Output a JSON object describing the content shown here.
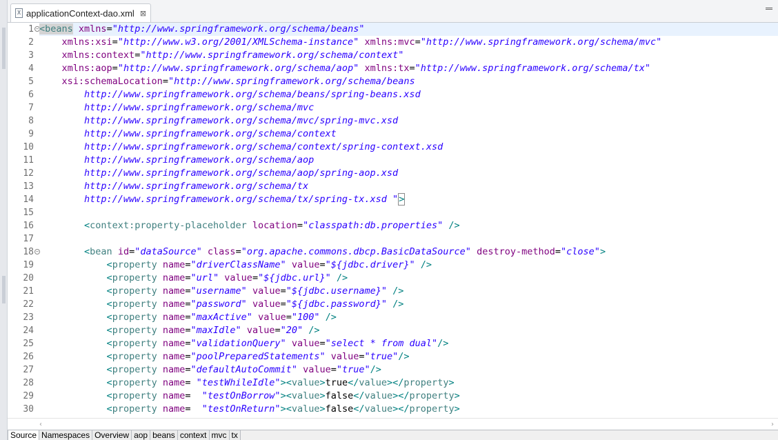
{
  "editor_tab": {
    "title": "applicationContext-dao.xml",
    "icon": "xml-file-icon",
    "close_glyph": "⊠",
    "icon_glyph": "X"
  },
  "current_line": 1,
  "fold_lines": [
    1,
    18
  ],
  "lines": [
    [
      [
        "tagsel",
        "<beans"
      ],
      [
        "sp",
        " "
      ],
      [
        "at",
        "xmlns"
      ],
      [
        "sp",
        "="
      ],
      [
        "av",
        "\"http://www.springframework.org/schema/beans\""
      ]
    ],
    [
      [
        "sp",
        "    "
      ],
      [
        "at",
        "xmlns:xsi"
      ],
      [
        "sp",
        "="
      ],
      [
        "av",
        "\"http://www.w3.org/2001/XMLSchema-instance\""
      ],
      [
        "sp",
        " "
      ],
      [
        "at",
        "xmlns:mvc"
      ],
      [
        "sp",
        "="
      ],
      [
        "av",
        "\"http://www.springframework.org/schema/mvc\""
      ]
    ],
    [
      [
        "sp",
        "    "
      ],
      [
        "at",
        "xmlns:context"
      ],
      [
        "sp",
        "="
      ],
      [
        "av",
        "\"http://www.springframework.org/schema/context\""
      ]
    ],
    [
      [
        "sp",
        "    "
      ],
      [
        "at",
        "xmlns:aop"
      ],
      [
        "sp",
        "="
      ],
      [
        "av",
        "\"http://www.springframework.org/schema/aop\""
      ],
      [
        "sp",
        " "
      ],
      [
        "at",
        "xmlns:tx"
      ],
      [
        "sp",
        "="
      ],
      [
        "av",
        "\"http://www.springframework.org/schema/tx\""
      ]
    ],
    [
      [
        "sp",
        "    "
      ],
      [
        "at",
        "xsi:schemaLocation"
      ],
      [
        "sp",
        "="
      ],
      [
        "av",
        "\"http://www.springframework.org/schema/beans"
      ]
    ],
    [
      [
        "sp",
        "        "
      ],
      [
        "av",
        "http://www.springframework.org/schema/beans/spring-beans.xsd"
      ]
    ],
    [
      [
        "sp",
        "        "
      ],
      [
        "av",
        "http://www.springframework.org/schema/mvc"
      ]
    ],
    [
      [
        "sp",
        "        "
      ],
      [
        "av",
        "http://www.springframework.org/schema/mvc/spring-mvc.xsd"
      ]
    ],
    [
      [
        "sp",
        "        "
      ],
      [
        "av",
        "http://www.springframework.org/schema/context"
      ]
    ],
    [
      [
        "sp",
        "        "
      ],
      [
        "av",
        "http://www.springframework.org/schema/context/spring-context.xsd"
      ]
    ],
    [
      [
        "sp",
        "        "
      ],
      [
        "av",
        "http://www.springframework.org/schema/aop"
      ]
    ],
    [
      [
        "sp",
        "        "
      ],
      [
        "av",
        "http://www.springframework.org/schema/aop/spring-aop.xsd"
      ]
    ],
    [
      [
        "sp",
        "        "
      ],
      [
        "av",
        "http://www.springframework.org/schema/tx"
      ]
    ],
    [
      [
        "sp",
        "        "
      ],
      [
        "av",
        "http://www.springframework.org/schema/tx/spring-tx.xsd \""
      ],
      [
        "box",
        ">"
      ]
    ],
    [],
    [
      [
        "sp",
        "        "
      ],
      [
        "pt",
        "<"
      ],
      [
        "tn",
        "context:property-placeholder"
      ],
      [
        "sp",
        " "
      ],
      [
        "at",
        "location"
      ],
      [
        "sp",
        "="
      ],
      [
        "av",
        "\"classpath:db.properties\""
      ],
      [
        "sp",
        " "
      ],
      [
        "pt",
        "/>"
      ]
    ],
    [],
    [
      [
        "sp",
        "        "
      ],
      [
        "pt",
        "<"
      ],
      [
        "tn",
        "bean"
      ],
      [
        "sp",
        " "
      ],
      [
        "at",
        "id"
      ],
      [
        "sp",
        "="
      ],
      [
        "av",
        "\"dataSource\""
      ],
      [
        "sp",
        " "
      ],
      [
        "at",
        "class"
      ],
      [
        "sp",
        "="
      ],
      [
        "av",
        "\"org.apache.commons.dbcp.BasicDataSource\""
      ],
      [
        "sp",
        " "
      ],
      [
        "at",
        "destroy-method"
      ],
      [
        "sp",
        "="
      ],
      [
        "av",
        "\"close\""
      ],
      [
        "pt",
        ">"
      ]
    ],
    [
      [
        "sp",
        "            "
      ],
      [
        "pt",
        "<"
      ],
      [
        "tn",
        "property"
      ],
      [
        "sp",
        " "
      ],
      [
        "at",
        "name"
      ],
      [
        "sp",
        "="
      ],
      [
        "av",
        "\"driverClassName\""
      ],
      [
        "sp",
        " "
      ],
      [
        "at",
        "value"
      ],
      [
        "sp",
        "="
      ],
      [
        "av",
        "\"${jdbc.driver}\""
      ],
      [
        "sp",
        " "
      ],
      [
        "pt",
        "/>"
      ]
    ],
    [
      [
        "sp",
        "            "
      ],
      [
        "pt",
        "<"
      ],
      [
        "tn",
        "property"
      ],
      [
        "sp",
        " "
      ],
      [
        "at",
        "name"
      ],
      [
        "sp",
        "="
      ],
      [
        "av",
        "\"url\""
      ],
      [
        "sp",
        " "
      ],
      [
        "at",
        "value"
      ],
      [
        "sp",
        "="
      ],
      [
        "av",
        "\"${jdbc.url}\""
      ],
      [
        "sp",
        " "
      ],
      [
        "pt",
        "/>"
      ]
    ],
    [
      [
        "sp",
        "            "
      ],
      [
        "pt",
        "<"
      ],
      [
        "tn",
        "property"
      ],
      [
        "sp",
        " "
      ],
      [
        "at",
        "name"
      ],
      [
        "sp",
        "="
      ],
      [
        "av",
        "\"username\""
      ],
      [
        "sp",
        " "
      ],
      [
        "at",
        "value"
      ],
      [
        "sp",
        "="
      ],
      [
        "av",
        "\"${jdbc.username}\""
      ],
      [
        "sp",
        " "
      ],
      [
        "pt",
        "/>"
      ]
    ],
    [
      [
        "sp",
        "            "
      ],
      [
        "pt",
        "<"
      ],
      [
        "tn",
        "property"
      ],
      [
        "sp",
        " "
      ],
      [
        "at",
        "name"
      ],
      [
        "sp",
        "="
      ],
      [
        "av",
        "\"password\""
      ],
      [
        "sp",
        " "
      ],
      [
        "at",
        "value"
      ],
      [
        "sp",
        "="
      ],
      [
        "av",
        "\"${jdbc.password}\""
      ],
      [
        "sp",
        " "
      ],
      [
        "pt",
        "/>"
      ]
    ],
    [
      [
        "sp",
        "            "
      ],
      [
        "pt",
        "<"
      ],
      [
        "tn",
        "property"
      ],
      [
        "sp",
        " "
      ],
      [
        "at",
        "name"
      ],
      [
        "sp",
        "="
      ],
      [
        "av",
        "\"maxActive\""
      ],
      [
        "sp",
        " "
      ],
      [
        "at",
        "value"
      ],
      [
        "sp",
        "="
      ],
      [
        "av",
        "\"100\""
      ],
      [
        "sp",
        " "
      ],
      [
        "pt",
        "/>"
      ]
    ],
    [
      [
        "sp",
        "            "
      ],
      [
        "pt",
        "<"
      ],
      [
        "tn",
        "property"
      ],
      [
        "sp",
        " "
      ],
      [
        "at",
        "name"
      ],
      [
        "sp",
        "="
      ],
      [
        "av",
        "\"maxIdle\""
      ],
      [
        "sp",
        " "
      ],
      [
        "at",
        "value"
      ],
      [
        "sp",
        "="
      ],
      [
        "av",
        "\"20\""
      ],
      [
        "sp",
        " "
      ],
      [
        "pt",
        "/>"
      ]
    ],
    [
      [
        "sp",
        "            "
      ],
      [
        "pt",
        "<"
      ],
      [
        "tn",
        "property"
      ],
      [
        "sp",
        " "
      ],
      [
        "at",
        "name"
      ],
      [
        "sp",
        "="
      ],
      [
        "av",
        "\"validationQuery\""
      ],
      [
        "sp",
        " "
      ],
      [
        "at",
        "value"
      ],
      [
        "sp",
        "="
      ],
      [
        "av",
        "\"select * from dual\""
      ],
      [
        "pt",
        "/>"
      ]
    ],
    [
      [
        "sp",
        "            "
      ],
      [
        "pt",
        "<"
      ],
      [
        "tn",
        "property"
      ],
      [
        "sp",
        " "
      ],
      [
        "at",
        "name"
      ],
      [
        "sp",
        "="
      ],
      [
        "av",
        "\"poolPreparedStatements\""
      ],
      [
        "sp",
        " "
      ],
      [
        "at",
        "value"
      ],
      [
        "sp",
        "="
      ],
      [
        "av",
        "\"true\""
      ],
      [
        "pt",
        "/>"
      ]
    ],
    [
      [
        "sp",
        "            "
      ],
      [
        "pt",
        "<"
      ],
      [
        "tn",
        "property"
      ],
      [
        "sp",
        " "
      ],
      [
        "at",
        "name"
      ],
      [
        "sp",
        "="
      ],
      [
        "av",
        "\"defaultAutoCommit\""
      ],
      [
        "sp",
        " "
      ],
      [
        "at",
        "value"
      ],
      [
        "sp",
        "="
      ],
      [
        "av",
        "\"true\""
      ],
      [
        "pt",
        "/>"
      ]
    ],
    [
      [
        "sp",
        "            "
      ],
      [
        "pt",
        "<"
      ],
      [
        "tn",
        "property"
      ],
      [
        "sp",
        " "
      ],
      [
        "at",
        "name"
      ],
      [
        "sp",
        "= "
      ],
      [
        "av",
        "\"testWhileIdle\""
      ],
      [
        "pt",
        "><"
      ],
      [
        "tn",
        "value"
      ],
      [
        "pt",
        ">"
      ],
      [
        "tx",
        "true"
      ],
      [
        "pt",
        "</"
      ],
      [
        "tn",
        "value"
      ],
      [
        "pt",
        "></"
      ],
      [
        "tn",
        "property"
      ],
      [
        "pt",
        ">"
      ]
    ],
    [
      [
        "sp",
        "            "
      ],
      [
        "pt",
        "<"
      ],
      [
        "tn",
        "property"
      ],
      [
        "sp",
        " "
      ],
      [
        "at",
        "name"
      ],
      [
        "sp",
        "=  "
      ],
      [
        "av",
        "\"testOnBorrow\""
      ],
      [
        "pt",
        "><"
      ],
      [
        "tn",
        "value"
      ],
      [
        "pt",
        ">"
      ],
      [
        "tx",
        "false"
      ],
      [
        "pt",
        "</"
      ],
      [
        "tn",
        "value"
      ],
      [
        "pt",
        "></"
      ],
      [
        "tn",
        "property"
      ],
      [
        "pt",
        ">"
      ]
    ],
    [
      [
        "sp",
        "            "
      ],
      [
        "pt",
        "<"
      ],
      [
        "tn",
        "property"
      ],
      [
        "sp",
        " "
      ],
      [
        "at",
        "name"
      ],
      [
        "sp",
        "=  "
      ],
      [
        "av",
        "\"testOnReturn\""
      ],
      [
        "pt",
        "><"
      ],
      [
        "tn",
        "value"
      ],
      [
        "pt",
        ">"
      ],
      [
        "tx",
        "false"
      ],
      [
        "pt",
        "</"
      ],
      [
        "tn",
        "value"
      ],
      [
        "pt",
        "></"
      ],
      [
        "tn",
        "property"
      ],
      [
        "pt",
        ">"
      ]
    ]
  ],
  "bottom_tabs": [
    "Source",
    "Namespaces",
    "Overview",
    "aop",
    "beans",
    "context",
    "mvc",
    "tx"
  ],
  "active_bottom_tab": "Source",
  "fold_glyph": "−",
  "scroll_left_glyph": "‹",
  "scroll_right_glyph": "›",
  "colors": {
    "tag_name": "#3f7f7f",
    "attribute": "#7f007f",
    "attribute_value": "#2a00ff",
    "punctuation": "#008080",
    "current_line_highlight": "#e8f2fe"
  }
}
